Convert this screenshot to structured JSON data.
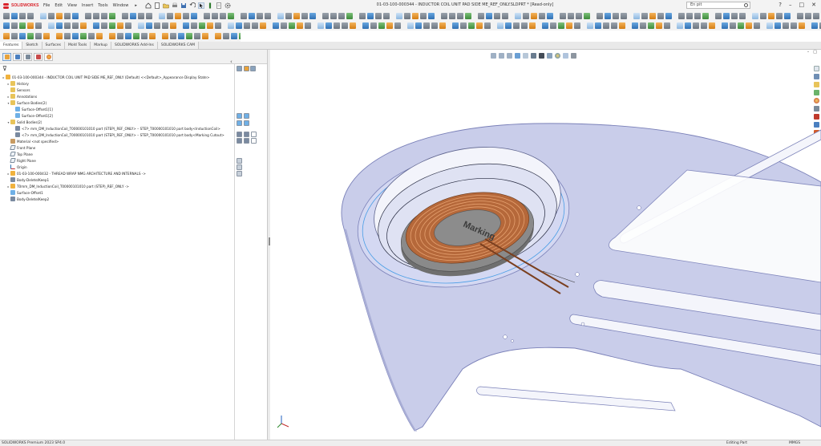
{
  "app": {
    "brand": "SOLIDWORKS",
    "window_title": "01-03-100-000344 - INDUCTOR COIL UNIT PAD SIDE ME_REF_ONLY.SLDPRT * [Read-only]",
    "menu": [
      "File",
      "Edit",
      "View",
      "Insert",
      "Tools",
      "Window"
    ],
    "menu_more": "▸",
    "search_value": "En pit",
    "window_controls": [
      "?",
      "–",
      "□",
      "✕"
    ]
  },
  "tabs": [
    "Features",
    "Sketch",
    "Surfaces",
    "Mold Tools",
    "Markup",
    "SOLIDWORKS Add-Ins",
    "SOLIDWORKS CAM"
  ],
  "active_tab_index": 0,
  "feature_tree": {
    "filter_icon": "filter-icon",
    "items": [
      {
        "label": "01-03-100-000344 - INDUCTOR COIL UNIT PAD SIDE ME_REF_ONLY (Default) <<Default>_Appearance Display State>",
        "icon": "part",
        "level": 0,
        "expander": "▸"
      },
      {
        "label": "History",
        "icon": "fold",
        "level": 1,
        "expander": "▸"
      },
      {
        "label": "Sensors",
        "icon": "fold",
        "level": 1,
        "expander": ""
      },
      {
        "label": "Annotations",
        "icon": "fold",
        "level": 1,
        "expander": "▸"
      },
      {
        "label": "Surface Bodies(2)",
        "icon": "fold",
        "level": 1,
        "expander": "▾"
      },
      {
        "label": "Surface-Offset1[1]",
        "icon": "surf",
        "level": 2,
        "expander": ""
      },
      {
        "label": "Surface-Offset1[2]",
        "icon": "surf",
        "level": 2,
        "expander": ""
      },
      {
        "label": "Solid Bodies(2)",
        "icon": "fold",
        "level": 1,
        "expander": "▾"
      },
      {
        "label": "<7> mm_DM_InductionCoil_T00000101010 part (STEP)_REF_ONLY> – STEP_T00000101010 part body<InductionCoil>",
        "icon": "solid",
        "level": 2,
        "expander": ""
      },
      {
        "label": "<7> mm_DM_InductionCoil_T00000101010 part (STEP)_REF_ONLY> – STEP_T00000101010 part body<Marking Cutout>",
        "icon": "solid",
        "level": 2,
        "expander": ""
      },
      {
        "label": "Material <not specified>",
        "icon": "mat",
        "level": 1,
        "expander": ""
      },
      {
        "label": "Front Plane",
        "icon": "plane",
        "level": 1,
        "expander": ""
      },
      {
        "label": "Top Plane",
        "icon": "plane",
        "level": 1,
        "expander": ""
      },
      {
        "label": "Right Plane",
        "icon": "plane",
        "level": 1,
        "expander": ""
      },
      {
        "label": "Origin",
        "icon": "orig",
        "level": 1,
        "expander": ""
      },
      {
        "label": "01-03-100-000432 - THREAD WRAP NMG ARCHITECTURE AND INTERNALS ->",
        "icon": "part",
        "level": 1,
        "expander": "▸"
      },
      {
        "label": "Body-Delete/Keep1",
        "icon": "solid",
        "level": 1,
        "expander": ""
      },
      {
        "label": "T0mm_DM_InductionCoil_T00000101010 part (STEP)_REF_ONLY ->",
        "icon": "part",
        "level": 1,
        "expander": "▸"
      },
      {
        "label": "Surface-Offset1",
        "icon": "surf",
        "level": 1,
        "expander": ""
      },
      {
        "label": "Body-Delete/Keep2",
        "icon": "solid",
        "level": 1,
        "expander": ""
      }
    ]
  },
  "viewport": {
    "coil_marking": "Marking",
    "colors": {
      "plate_fill": "#c9cdea",
      "plate_edge": "#7a80b8",
      "coil_copper": "#b5683a",
      "disc_gray": "#8a8a8a",
      "accent_edge": "#4a9ee6"
    }
  },
  "status": {
    "left": "SOLIDWORKS Premium 2023 SP4.0",
    "mid": "Editing Part",
    "units": "MMGS"
  }
}
